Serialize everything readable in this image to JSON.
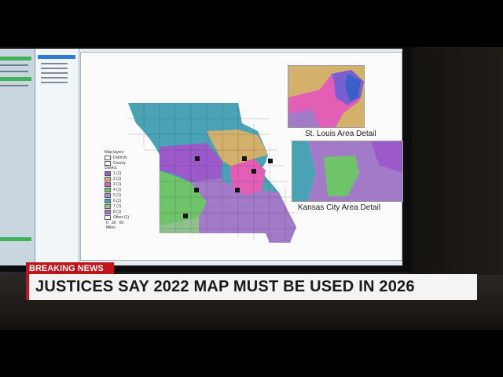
{
  "banner": {
    "tag": "BREAKING NEWS",
    "headline": "JUSTICES SAY 2022 MAP MUST BE USED IN 2026"
  },
  "map": {
    "legend_title": "Map layers",
    "legend_items": [
      "Districts",
      "County",
      "District",
      "1 (1)",
      "2 (1)",
      "3 (1)",
      "4 (1)",
      "5 (1)",
      "6 (1)",
      "7 (1)",
      "8 (1)",
      "Other (1)"
    ],
    "scale_ticks": [
      "0",
      "30",
      "60"
    ],
    "scale_unit": "Miles",
    "insets": {
      "st_louis": "St. Louis Area Detail",
      "kansas_city": "Kansas City Area Detail"
    }
  },
  "colors": {
    "tag_red": "#c4121a",
    "district_1": "#9b59c9",
    "district_2": "#d4b16a",
    "district_3": "#e35fb5",
    "district_4": "#6fc46a",
    "district_5": "#a78bd6",
    "district_6": "#4aa3b5",
    "district_7": "#8fc18c",
    "district_8": "#a27ac7"
  }
}
